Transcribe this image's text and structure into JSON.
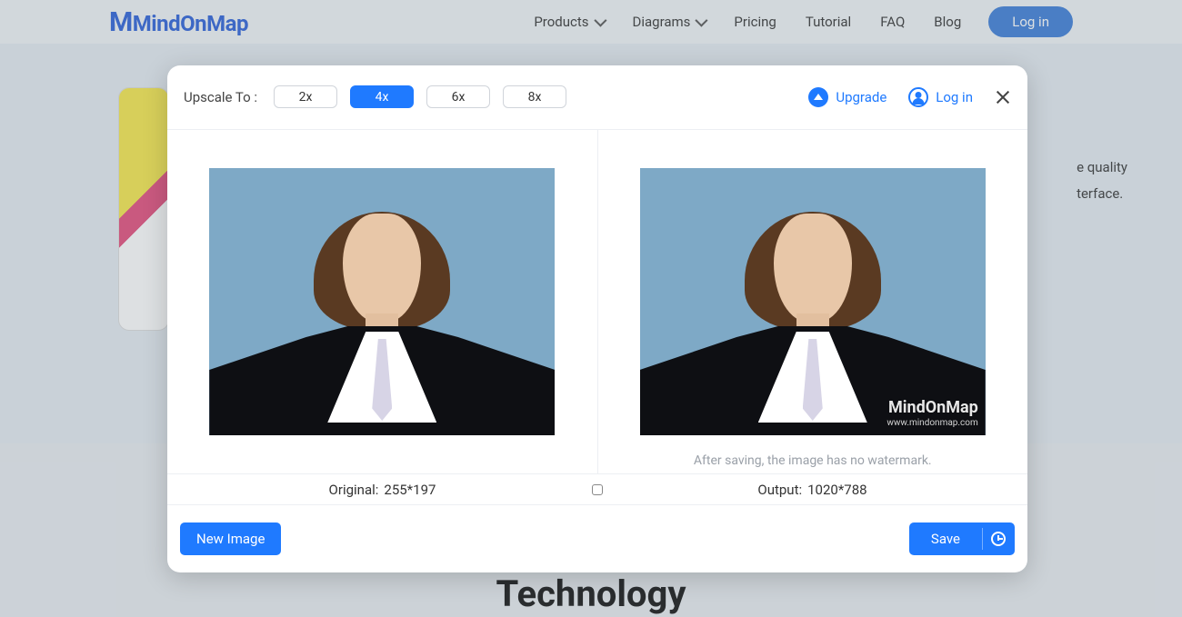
{
  "nav": {
    "brand": "MindOnMap",
    "items": [
      "Products",
      "Diagrams",
      "Pricing",
      "Tutorial",
      "FAQ",
      "Blog"
    ],
    "login": "Log in"
  },
  "bg": {
    "line1": "e quality",
    "line2": "terface.",
    "heading": "Technology"
  },
  "modal": {
    "upscale_label": "Upscale To :",
    "scales": [
      "2x",
      "4x",
      "6x",
      "8x"
    ],
    "active_scale": "4x",
    "upgrade": "Upgrade",
    "login": "Log in",
    "watermark_brand": "MindOnMap",
    "watermark_url": "www.mindonmap.com",
    "note": "After saving, the image has no watermark.",
    "original_label": "Original:",
    "original_value": "255*197",
    "output_label": "Output:",
    "output_value": "1020*788",
    "new_image": "New Image",
    "save": "Save"
  }
}
